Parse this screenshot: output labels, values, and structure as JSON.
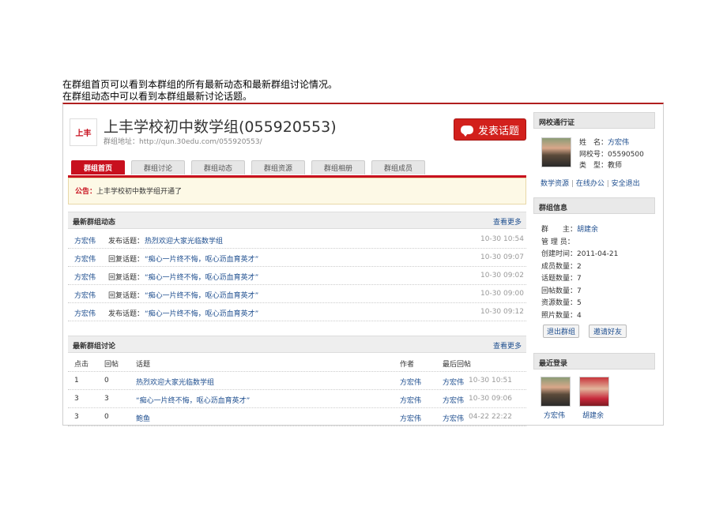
{
  "intro": {
    "line1": "在群组首页可以看到本群组的所有最新动态和最新群组讨论情况。",
    "line2": "在群组动态中可以看到本群组最新讨论话题。"
  },
  "header": {
    "logo_text": "上丰",
    "title": "上丰学校初中数学组(055920553)",
    "address": "群组地址：http://qun.30edu.com/055920553/",
    "post_button": "发表话题"
  },
  "tabs": [
    "群组首页",
    "群组讨论",
    "群组动态",
    "群组资源",
    "群组相册",
    "群组成员"
  ],
  "notice": {
    "label": "公告：",
    "text": "上丰学校初中数学组开通了"
  },
  "activity": {
    "title": "最新群组动态",
    "more": "查看更多",
    "rows": [
      {
        "user": "方宏伟",
        "action": "发布话题：",
        "topic": "热烈欢迎大家光临数学组",
        "time": "10-30 10:54"
      },
      {
        "user": "方宏伟",
        "action": "回复话题：",
        "topic": "“痴心一片终不悔，呕心沥血育英才”",
        "time": "10-30 09:07"
      },
      {
        "user": "方宏伟",
        "action": "回复话题：",
        "topic": "“痴心一片终不悔，呕心沥血育英才”",
        "time": "10-30 09:02"
      },
      {
        "user": "方宏伟",
        "action": "回复话题：",
        "topic": "“痴心一片终不悔，呕心沥血育英才”",
        "time": "10-30 09:00"
      },
      {
        "user": "方宏伟",
        "action": "发布话题：",
        "topic": "“痴心一片终不悔，呕心沥血育英才”",
        "time": "10-30 09:12"
      }
    ]
  },
  "discussion": {
    "title": "最新群组讨论",
    "more": "查看更多",
    "columns": [
      "点击",
      "回帖",
      "话题",
      "作者",
      "最后回帖"
    ],
    "rows": [
      {
        "clicks": "1",
        "replies": "0",
        "topic": "热烈欢迎大家光临数学组",
        "author": "方宏伟",
        "last_user": "方宏伟",
        "last_time": "10-30 10:51"
      },
      {
        "clicks": "3",
        "replies": "3",
        "topic": "“痴心一片终不悔，呕心沥血育英才”",
        "author": "方宏伟",
        "last_user": "方宏伟",
        "last_time": "10-30 09:06"
      },
      {
        "clicks": "3",
        "replies": "0",
        "topic": "鲍鱼",
        "author": "方宏伟",
        "last_user": "方宏伟",
        "last_time": "04-22 22:22"
      }
    ]
  },
  "sidebar": {
    "pass": {
      "title": "网校通行证",
      "name_label": "姓　名：",
      "name": "方宏伟",
      "id_label": "网校号：",
      "id": "05590500",
      "type_label": "类　型：",
      "type": "教师",
      "links": [
        "数学资源",
        "在线办公",
        "安全退出"
      ]
    },
    "info": {
      "title": "群组信息",
      "owner_label": "群　　主：",
      "owner": "胡建余",
      "admin_label": "管 理 员：",
      "admin": "",
      "created_label": "创建时间：",
      "created": "2011-04-21",
      "members_label": "成员数量：",
      "members": "2",
      "topics_label": "话题数量：",
      "topics": "7",
      "posts_label": "回帖数量：",
      "posts": "7",
      "resources_label": "资源数量：",
      "resources": "5",
      "photos_label": "照片数量：",
      "photos": "4",
      "quit_button": "退出群组",
      "invite_button": "邀请好友"
    },
    "recent": {
      "title": "最近登录",
      "users": [
        "方宏伟",
        "胡建余"
      ]
    }
  },
  "colors": {
    "brand_red": "#c8101e",
    "link_blue": "#1e4e8f"
  }
}
